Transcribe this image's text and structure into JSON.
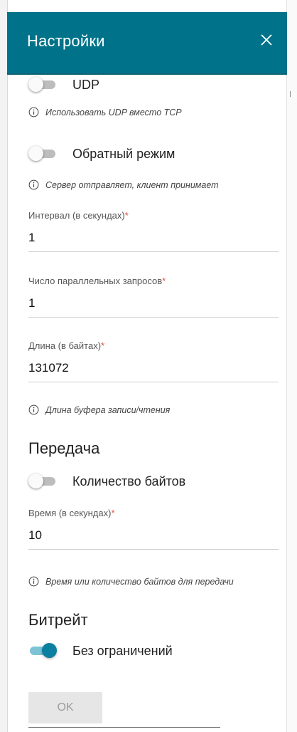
{
  "header": {
    "title": "Настройки"
  },
  "toggles": {
    "udp": {
      "label": "UDP",
      "on": false,
      "hint": "Использовать UDP вместо TCP"
    },
    "reverse": {
      "label": "Обратный режим",
      "on": false,
      "hint": "Сервер отправляет, клиент принимает"
    }
  },
  "fields": {
    "interval": {
      "label": "Интервал (в секундах)",
      "value": "1"
    },
    "parallel": {
      "label": "Число параллельных запросов",
      "value": "1"
    },
    "length": {
      "label": "Длина (в байтах)",
      "value": "131072",
      "hint": "Длина буфера записи/чтения"
    },
    "time": {
      "label": "Время (в секундах)",
      "value": "10",
      "hint": "Время или количество байтов для передачи"
    },
    "required_mark": "*"
  },
  "transfer": {
    "title": "Передача",
    "bytes_toggle": {
      "label": "Количество байтов",
      "on": false
    }
  },
  "bitrate": {
    "title": "Битрейт",
    "unlimited_toggle": {
      "label": "Без ограничений",
      "on": true
    }
  },
  "ok_button": {
    "label": "OK"
  },
  "icons": {
    "close": "close-icon",
    "info": "info-icon"
  },
  "colors": {
    "header": "#00738a",
    "toggle_on": "#0b7fa0",
    "required": "#e0523f"
  }
}
